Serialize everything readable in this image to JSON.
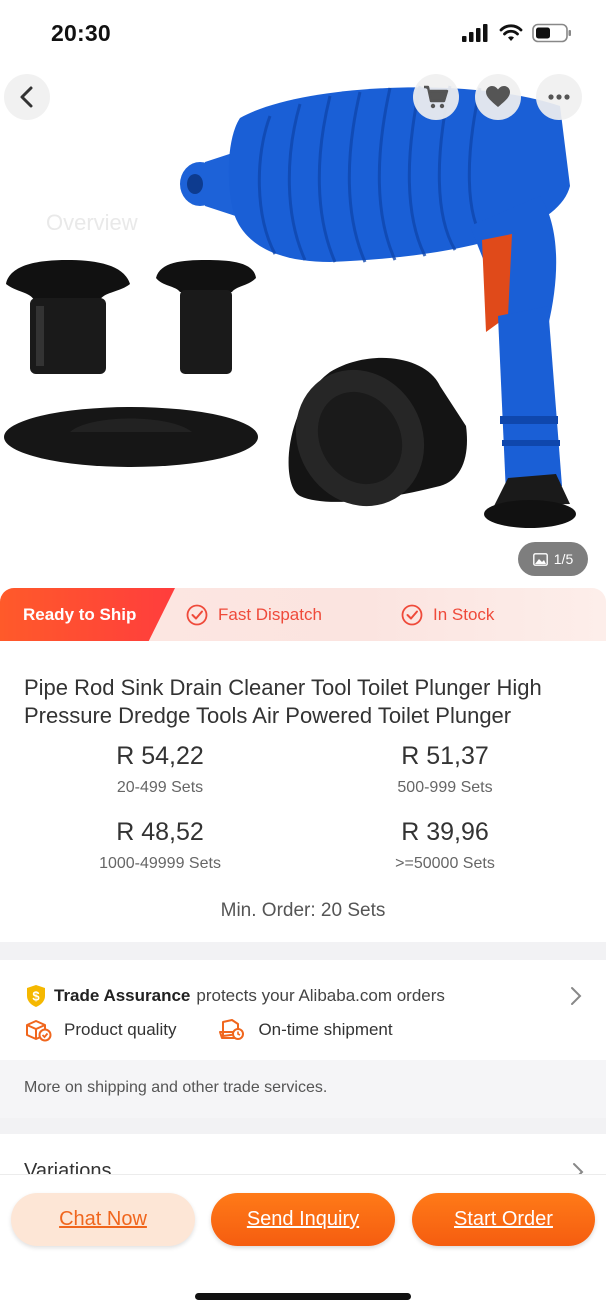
{
  "status_bar": {
    "time": "20:30"
  },
  "header": {
    "overview_ghost": "Overview"
  },
  "gallery": {
    "counter": "1/5"
  },
  "shipping_tags": {
    "ready": "Ready to Ship",
    "fast": "Fast Dispatch",
    "stock": "In Stock"
  },
  "product": {
    "title": "Pipe Rod Sink Drain Cleaner Tool Toilet Plunger High Pressure Dredge Tools Air Powered Toilet Plunger",
    "tiers": [
      {
        "price": "R 54,22",
        "qty": "20-499 Sets"
      },
      {
        "price": "R 51,37",
        "qty": "500-999 Sets"
      },
      {
        "price": "R 48,52",
        "qty": "1000-49999 Sets"
      },
      {
        "price": "R 39,96",
        "qty": ">=50000 Sets"
      }
    ],
    "min_order": "Min. Order: 20 Sets"
  },
  "trade": {
    "title": "Trade Assurance",
    "subtitle": "protects your Alibaba.com orders",
    "feature1": "Product quality",
    "feature2": "On-time shipment",
    "more": "More on shipping and other trade services."
  },
  "variations": {
    "label": "Variations"
  },
  "actions": {
    "chat": "Chat Now",
    "inquiry": "Send Inquiry",
    "order": "Start Order"
  },
  "colors": {
    "accent": "#f55d10",
    "tag_red": "#ef4a3a",
    "product_blue": "#1a5fd6"
  }
}
